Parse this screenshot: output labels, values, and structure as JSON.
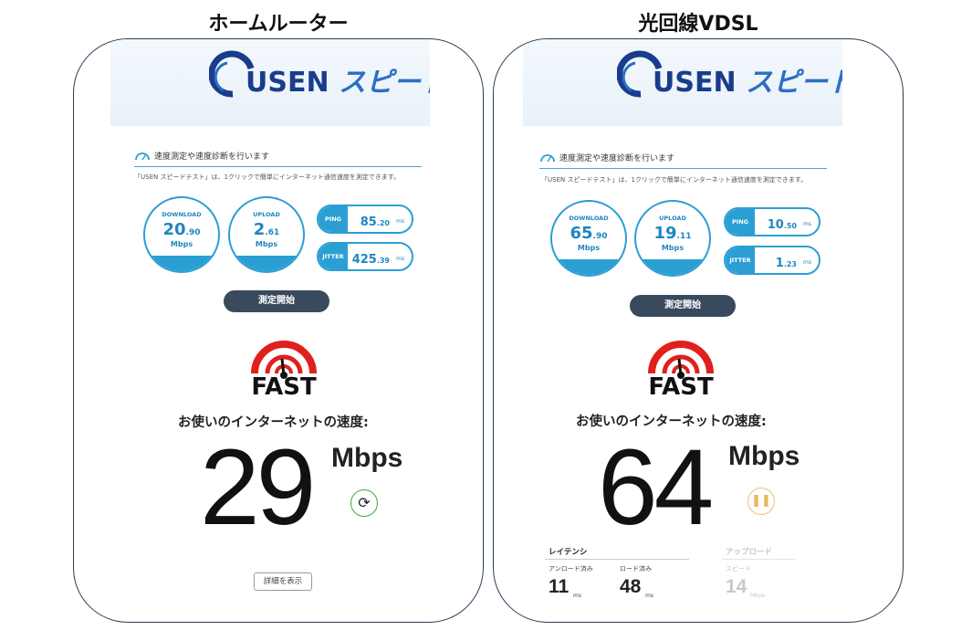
{
  "titles": {
    "left": "ホームルーター",
    "right": "光回線VDSL"
  },
  "colors": {
    "accent": "#2b9fd4",
    "fast_red": "#e0201c",
    "button_dark": "#3a4a5e"
  },
  "usen": {
    "logo_text": "USEN",
    "logo_jp": "スピードテ",
    "section_title": "速度測定や速度診断を行います",
    "description": "「USEN スピードテスト」は、1クリックで簡単にインターネット通信速度を測定できます。",
    "labels": {
      "download": "DOWNLOAD",
      "upload": "UPLOAD",
      "ping": "PING",
      "jitter": "JITTER",
      "mbps": "Mbps",
      "ms": "ms"
    },
    "start_button": "測定開始"
  },
  "left": {
    "download": {
      "int": "20",
      "dec": ".90"
    },
    "upload": {
      "int": "2",
      "dec": ".61"
    },
    "ping": {
      "int": "85",
      "dec": ".20"
    },
    "jitter": {
      "int": "425",
      "dec": ".39"
    }
  },
  "right": {
    "download": {
      "int": "65",
      "dec": ".90"
    },
    "upload": {
      "int": "19",
      "dec": ".11"
    },
    "ping": {
      "int": "10",
      "dec": ".50"
    },
    "jitter": {
      "int": "1",
      "dec": ".23"
    }
  },
  "fast": {
    "logo_text": "FAST",
    "caption": "お使いのインターネットの速度:",
    "unit": "Mbps",
    "left_speed": "29",
    "right_speed": "64",
    "details_button": "詳細を表示",
    "refresh_icon": "refresh-icon",
    "pause_icon": "pause-icon"
  },
  "latency": {
    "heading": "レイテンシ",
    "unloaded_label": "アンロード済み",
    "unloaded_value": "11",
    "loaded_label": "ロード済み",
    "loaded_value": "48",
    "unit": "ms",
    "upload_heading": "アップロード",
    "upload_sub_label": "スピード",
    "upload_value": "14",
    "upload_unit": "Mbps"
  }
}
